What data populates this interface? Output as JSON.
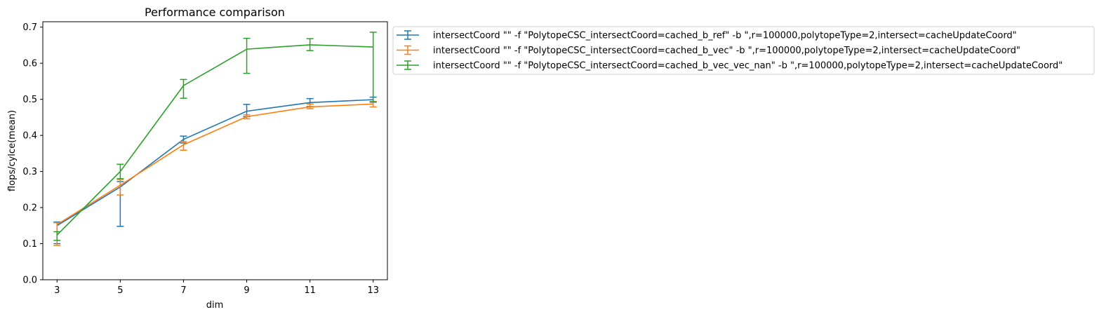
{
  "chart_data": {
    "type": "line",
    "title": "Performance comparison",
    "xlabel": "dim",
    "ylabel": "flops/cylce(mean)",
    "x": [
      3,
      5,
      7,
      9,
      11,
      13
    ],
    "x_ticks": [
      "3",
      "5",
      "7",
      "9",
      "11",
      "13"
    ],
    "y_ticks": [
      "0.0",
      "0.1",
      "0.2",
      "0.3",
      "0.4",
      "0.5",
      "0.6",
      "0.7"
    ],
    "xlim": [
      2.55,
      13.45
    ],
    "ylim": [
      0,
      0.715
    ],
    "grid": false,
    "legend_position": "outside-top-right",
    "error_bars": true,
    "series": [
      {
        "name": "intersectCoord \"\" -f \"PolytopeCSC_intersectCoord=cached_b_ref\" -b \",r=100000,polytopeType=2,intersect=cacheUpdateCoord\"",
        "color": "#1f77b4",
        "values": [
          0.15,
          0.257,
          0.389,
          0.467,
          0.491,
          0.499
        ],
        "err_low": [
          0.1,
          0.148,
          0.379,
          0.452,
          0.48,
          0.492
        ],
        "err_high": [
          0.16,
          0.272,
          0.398,
          0.486,
          0.502,
          0.506
        ]
      },
      {
        "name": "intersectCoord \"\" -f \"PolytopeCSC_intersectCoord=cached_b_vec\" -b \",r=100000,polytopeType=2,intersect=cacheUpdateCoord\"",
        "color": "#ff7f0e",
        "values": [
          0.153,
          0.262,
          0.374,
          0.452,
          0.479,
          0.487
        ],
        "err_low": [
          0.095,
          0.235,
          0.359,
          0.446,
          0.474,
          0.479
        ],
        "err_high": [
          0.158,
          0.278,
          0.383,
          0.457,
          0.487,
          0.494
        ]
      },
      {
        "name": "intersectCoord \"\" -f \"PolytopeCSC_intersectCoord=cached_b_vec_vec_nan\" -b \",r=100000,polytopeType=2,intersect=cacheUpdateCoord\"",
        "color": "#2ca02c",
        "values": [
          0.124,
          0.3,
          0.538,
          0.639,
          0.651,
          0.645
        ],
        "err_low": [
          0.109,
          0.28,
          0.503,
          0.572,
          0.635,
          0.493
        ],
        "err_high": [
          0.133,
          0.32,
          0.555,
          0.669,
          0.668,
          0.686
        ]
      }
    ]
  }
}
